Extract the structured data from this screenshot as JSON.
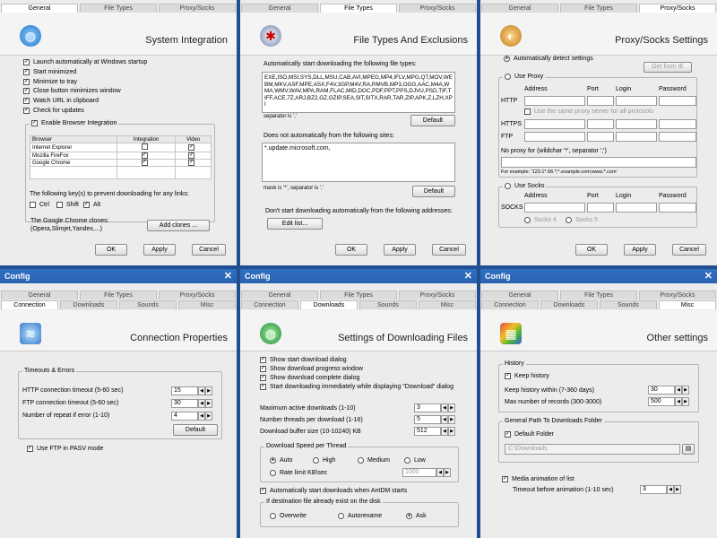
{
  "tabs": {
    "top": [
      "General",
      "File Types",
      "Proxy/Socks"
    ],
    "bottom": [
      "Connection",
      "Downloads",
      "Sounds",
      "Misc"
    ]
  },
  "window_title": "Config",
  "buttons": {
    "ok": "OK",
    "apply": "Apply",
    "cancel": "Cancel"
  },
  "general": {
    "title": "System Integration",
    "options": [
      "Launch automatically at Windows startup",
      "Start minimized",
      "Minimize to tray",
      "Close button minimizes window",
      "Watch URL in clipboard",
      "Check for updates"
    ],
    "browser_integration": "Enable Browser Integration",
    "table_headers": [
      "Browser",
      "Integration",
      "Video"
    ],
    "browsers": [
      "Internet Explorer",
      "Mozilla FireFox",
      "Google Chrome"
    ],
    "keys_label": "The following key(s) to prevent downloading for any links:",
    "keys": [
      "Ctrl",
      "Shift",
      "Alt"
    ],
    "clones_label": "The Google Chrome clones:",
    "clones_example": "(Opera,Slimjet,Yandex,...)",
    "add_clones": "Add clones ..."
  },
  "filetypes": {
    "title": "File Types And Exclusions",
    "auto_label": "Automatically start downloading the following file types:",
    "types": "EXE,ISO,MSI,SYS,DLL,MSU,CAB,AVI,MPEG,MP4,IFLV,MPG,QT,MOV,WEBM,MKV,ASF,MPE,ASX,F4V,3GP,M4V,RA,RMVB,MP3,OGG,AAC,M4A,WMA,WMV,WAV,MPA,RAM,FLAC,MID,DOC,PDF,PPT,PPS,DJVU,PSD,TIF,TIFF,ACE,7Z,ARJ,BZ2,GZ,GZIP,SEA,SIT,SITX,RAR,TAR,ZIP,APK,Z,LZH,XPI",
    "separator": "separator is ','",
    "default": "Default",
    "sites_label": "Does not automatically from the following sites:",
    "sites": "*.update.microsoft.com,",
    "mask": "mask is '*', separator is ','",
    "addr_label": "Don't start downloading automatically from the following addresses:",
    "edit_list": "Edit list..."
  },
  "proxy": {
    "title": "Proxy/Socks Settings",
    "auto_detect": "Automatically detect settings",
    "get_from_ie": "Get from IE",
    "use_proxy": "Use Proxy",
    "cols": [
      "Address",
      "Port",
      "Login",
      "Password"
    ],
    "rows": [
      "HTTP",
      "HTTPS",
      "FTP"
    ],
    "same_proxy": "Use the same proxy server for all protocols",
    "no_proxy": "No proxy for (wildchar '*', separator ';')",
    "example": "For example: '123.1*.66.*;*.example.com;www.*.com'",
    "use_socks": "Use Socks",
    "socks": "SOCKS",
    "socks4": "Socks 4",
    "socks5": "Socks 5"
  },
  "connection": {
    "title": "Connection Properties",
    "group": "Timeouts & Errors",
    "http_label": "HTTP connection timeout (5-60 sec)",
    "http_value": "15",
    "ftp_label": "FTP connection timeout (5-60 sec)",
    "ftp_value": "30",
    "repeat_label": "Number of repeat if error (1-10)",
    "repeat_value": "4",
    "default": "Default",
    "pasv": "Use FTP in PASV mode"
  },
  "downloads": {
    "title": "Settings of Downloading Files",
    "options": [
      "Show start download dialog",
      "Show download progress window",
      "Show download complete dialog",
      "Start downloading immediately while displaying \"Download\" dialog"
    ],
    "max_active_label": "Maximum active downloads (1-10)",
    "max_active_value": "3",
    "threads_label": "Number threads per download (1-16)",
    "threads_value": "5",
    "buffer_label": "Download buffer size (10-10240) KB",
    "buffer_value": "512",
    "speed_group": "Download Speed per Thread",
    "speeds": [
      "Auto",
      "High",
      "Medium",
      "Low"
    ],
    "rate_limit": "Rate limit KB\\sec",
    "rate_value": "1000",
    "auto_antdm": "Automatically start downloads when AntDM starts",
    "exists_group": "If destination file already exist on the disk",
    "exists_opts": [
      "Overwrite",
      "Autorename",
      "Ask"
    ]
  },
  "misc": {
    "title": "Other settings",
    "history_group": "History",
    "keep_history": "Keep history",
    "keep_within_label": "Keep history within (7-360 days)",
    "keep_within_value": "30",
    "max_records_label": "Max number of records (300-3000)",
    "max_records_value": "500",
    "path_group": "General Path To Downloads Folder",
    "default_folder": "Default Folder",
    "folder_path": "C:\\Downloads",
    "media_anim": "Media animation of list",
    "anim_timeout_label": "Timeout before animation (1-10 sec)",
    "anim_timeout_value": "3"
  }
}
